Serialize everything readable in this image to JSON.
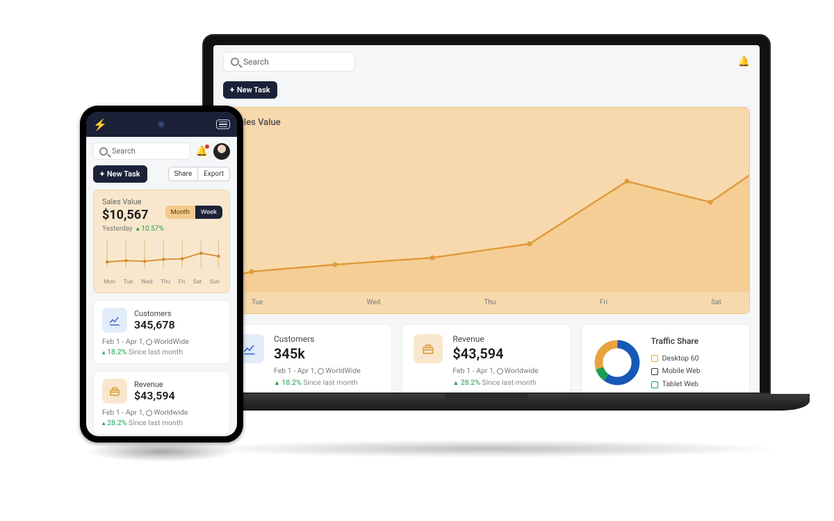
{
  "search": {
    "placeholder": "Search"
  },
  "buttons": {
    "newTask": "New Task",
    "share": "Share",
    "export": "Export"
  },
  "salesChart": {
    "title": "Sales Value",
    "value": "$10,567",
    "yesterdayLabel": "Yesterday",
    "yesterdayDelta": "10.57%",
    "toggle": {
      "month": "Month",
      "week": "Week"
    },
    "daysShort": {
      "mon": "Mon",
      "tue": "Tue",
      "wed": "Wed",
      "thu": "Thu",
      "fri": "Fri",
      "sat": "Sat",
      "sun": "Sun"
    },
    "axisDays": {
      "tue": "Tue",
      "wed": "Wed",
      "thu": "Thu",
      "fri": "Fri",
      "sat": "Sat"
    }
  },
  "customers": {
    "label": "Customers",
    "valueMobile": "345,678",
    "valueLaptop": "345k",
    "range": "Feb 1 - Apr 1,",
    "scope": "WorldWide",
    "delta": "18.2%",
    "deltaSuffix": "Since last month"
  },
  "revenue": {
    "label": "Revenue",
    "value": "$43,594",
    "range": "Feb 1 - Apr 1,",
    "scope": "Worldwide",
    "delta": "28.2%",
    "deltaSuffix": "Since last month"
  },
  "traffic": {
    "label": "Traffic Share",
    "desktop": "Desktop 60",
    "mobile": "Mobile Web",
    "tablet": "Tablet Web"
  },
  "chart_data": [
    {
      "type": "line",
      "title": "Sales Value",
      "categories": [
        "Mon",
        "Tue",
        "Wed",
        "Thu",
        "Fri",
        "Sat",
        "Sun"
      ],
      "series": [
        {
          "name": "Sales",
          "values": [
            18,
            22,
            28,
            40,
            78,
            62,
            88
          ]
        }
      ],
      "ylim": [
        0,
        100
      ]
    },
    {
      "type": "line",
      "title": "Sales Value (week, mobile)",
      "categories": [
        "Mon",
        "Tue",
        "Wed",
        "Thu",
        "Fri",
        "Sat",
        "Sun"
      ],
      "series": [
        {
          "name": "Sales",
          "values": [
            30,
            34,
            32,
            38,
            40,
            58,
            48
          ]
        }
      ],
      "ylim": [
        0,
        100
      ]
    },
    {
      "type": "pie",
      "title": "Traffic Share",
      "categories": [
        "Desktop",
        "Mobile Web",
        "Tablet Web"
      ],
      "values": [
        60,
        30,
        10
      ]
    }
  ]
}
